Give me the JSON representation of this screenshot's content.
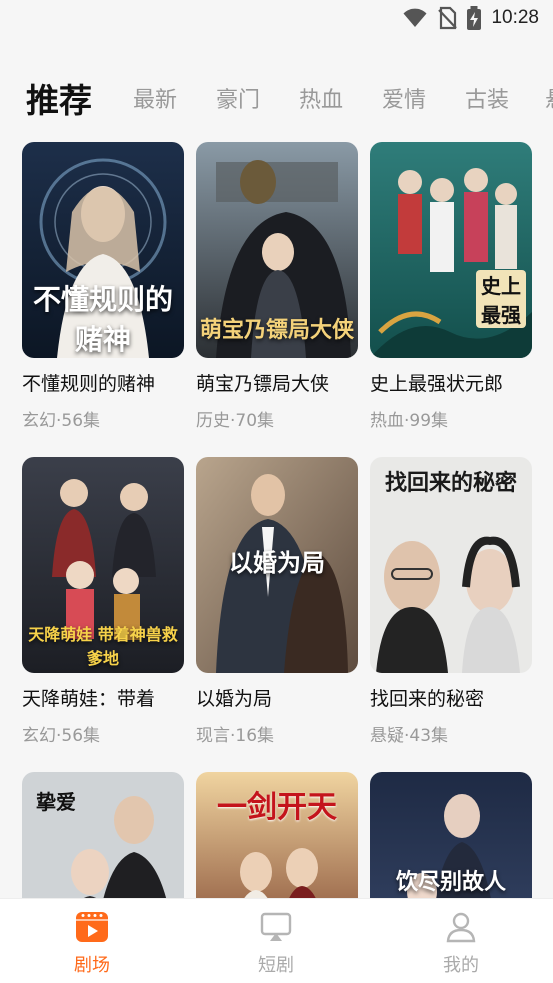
{
  "status": {
    "time": "10:28"
  },
  "tabs": [
    {
      "label": "推荐",
      "active": true
    },
    {
      "label": "最新"
    },
    {
      "label": "豪门"
    },
    {
      "label": "热血"
    },
    {
      "label": "爱情"
    },
    {
      "label": "古装"
    },
    {
      "label": "悬"
    }
  ],
  "cards": [
    {
      "title": "不懂规则的赌神",
      "meta": "玄幻·56集",
      "poster_text": "不懂规则的赌神"
    },
    {
      "title": "萌宝乃镖局大侠",
      "meta": "历史·70集",
      "poster_text": "萌宝乃镖局大侠"
    },
    {
      "title": "史上最强状元郎",
      "meta": "热血·99集",
      "poster_text": "史上最强"
    },
    {
      "title": "天降萌娃：带着",
      "meta": "玄幻·56集",
      "poster_text": "天降萌娃 带着神兽救爹地"
    },
    {
      "title": "以婚为局",
      "meta": "现言·16集",
      "poster_text": "以婚为局"
    },
    {
      "title": "找回来的秘密",
      "meta": "悬疑·43集",
      "poster_text": "找回来的秘密"
    },
    {
      "title": "",
      "meta": "",
      "poster_text": "挚爱"
    },
    {
      "title": "",
      "meta": "",
      "poster_text": "一剑开天"
    },
    {
      "title": "",
      "meta": "",
      "poster_text": "饮尽别故人"
    }
  ],
  "nav": [
    {
      "label": "剧场",
      "icon": "theater-icon",
      "active": true
    },
    {
      "label": "短剧",
      "icon": "cast-screen-icon"
    },
    {
      "label": "我的",
      "icon": "profile-icon"
    }
  ],
  "colors": {
    "accent": "#ff6a1a",
    "inactive": "#aaaaaa"
  }
}
